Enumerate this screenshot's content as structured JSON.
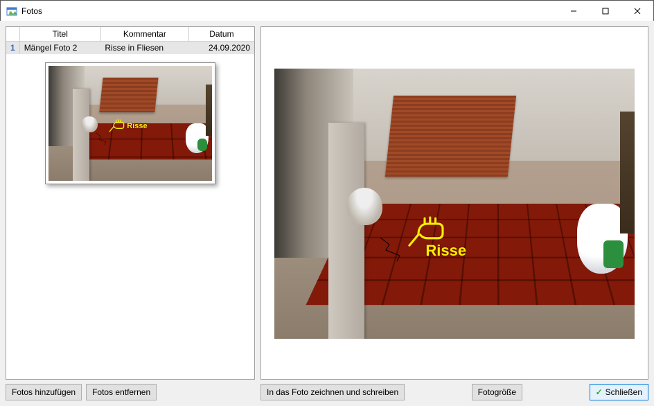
{
  "window": {
    "title": "Fotos"
  },
  "table": {
    "headers": {
      "title": "Titel",
      "comment": "Kommentar",
      "date": "Datum"
    },
    "rows": [
      {
        "num": "1",
        "title": "Mängel Foto 2",
        "comment": "Risse in Fliesen",
        "date": "24.09.2020"
      }
    ]
  },
  "annotation": {
    "label": "Risse"
  },
  "buttons": {
    "add": "Fotos hinzufügen",
    "remove": "Fotos entfernen",
    "draw": "In das Foto zeichnen und schreiben",
    "size": "Fotogröße",
    "close": "Schließen"
  }
}
